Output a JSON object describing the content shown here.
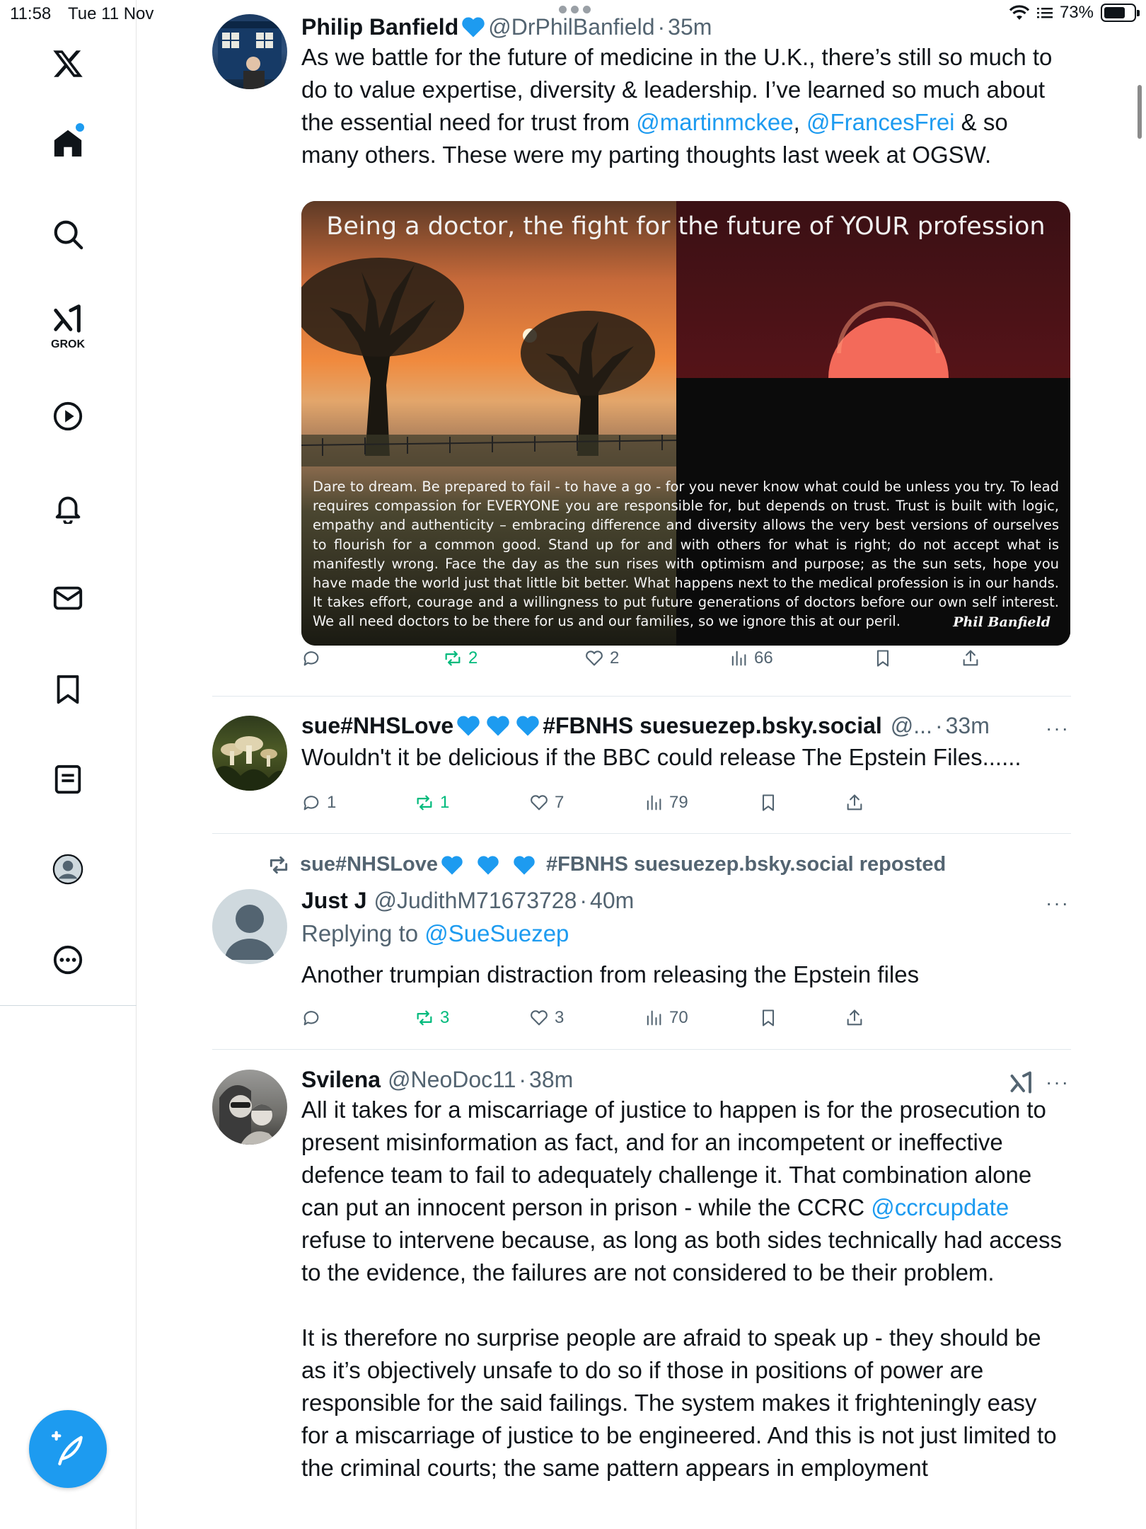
{
  "status_bar": {
    "time": "11:58",
    "date": "Tue 11 Nov",
    "battery": "73%",
    "battery_level": 0.73
  },
  "sidebar": {
    "items": [
      {
        "name": "logo",
        "icon": "x-logo-icon"
      },
      {
        "name": "home",
        "icon": "home-icon"
      },
      {
        "name": "explore",
        "icon": "search-icon"
      },
      {
        "name": "grok",
        "icon": "grok-icon",
        "label": "GROK"
      },
      {
        "name": "video",
        "icon": "play-icon"
      },
      {
        "name": "notifications",
        "icon": "bell-icon"
      },
      {
        "name": "messages",
        "icon": "mail-icon"
      },
      {
        "name": "bookmarks",
        "icon": "bookmark-icon"
      },
      {
        "name": "articles",
        "icon": "article-icon"
      },
      {
        "name": "profile",
        "icon": "avatar-icon"
      },
      {
        "name": "more",
        "icon": "more-circle-icon"
      }
    ],
    "compose_icon": "compose-feather-icon"
  },
  "colors": {
    "accent": "#1d9bf0",
    "retweet": "#00ba7c",
    "secondary_text": "#536471",
    "heart_blue": "#1d9bf0"
  },
  "tweets": [
    {
      "name": "Philip Banfield",
      "handle": "@DrPhilBanfield",
      "sep": "·",
      "time": "35m",
      "text_parts": [
        "As we battle for the future of medicine in the U.K., there’s still so much to do to value expertise, diversity & leadership. I’ve learned so much about the essential need for trust from ",
        "@martinmckee",
        ", ",
        "@FrancesFrei",
        " & so many others. These were my parting thoughts last week at OGSW."
      ],
      "media": {
        "title": "Being a doctor, the fight for the future of YOUR profession",
        "caption": "Dare to dream. Be prepared to fail - to have a go - for you never know what could be unless you try. To lead requires compassion for EVERYONE you are responsible for, but depends on trust. Trust is built with logic, empathy and authenticity – embracing difference and diversity allows the very best versions of ourselves to flourish for a common good. Stand up for and with others for what is right; do not accept what is manifestly wrong. Face the day as the sun rises with optimism and purpose; as the sun sets, hope you have made the world just that little bit better. What happens next to the medical profession is in our hands. It takes effort, courage and a willingness to put future generations of doctors before our own self interest. We all need doctors to be there for us and our families, so we ignore this at our peril.",
        "signature": "Phil Banfield"
      },
      "stats": {
        "replies": "",
        "reposts": "2",
        "likes": "2",
        "views": "66"
      }
    },
    {
      "name_prefix": "sue#NHSLove",
      "name_suffix": "#FBNHS suesuezep.bsky.social",
      "handle": "@...",
      "sep": "·",
      "time": "33m",
      "text": "Wouldn't it be delicious if the BBC could release The Epstein Files......",
      "more": "···",
      "stats": {
        "replies": "1",
        "reposts": "1",
        "likes": "7",
        "views": "79"
      }
    },
    {
      "repost_prefix": "sue#NHSLove",
      "repost_suffix": "#FBNHS suesuezep.bsky.social reposted",
      "name": "Just J",
      "handle": "@JudithM71673728",
      "sep": "·",
      "time": "40m",
      "replying_to_label": "Replying to ",
      "replying_to": "@SueSuezep",
      "text": "Another trumpian distraction from releasing the Epstein files",
      "more": "···",
      "stats": {
        "replies": "",
        "reposts": "3",
        "likes": "3",
        "views": "70"
      }
    },
    {
      "name": "Svilena",
      "handle": "@NeoDoc11",
      "sep": "·",
      "time": "38m",
      "more": "···",
      "text_parts": [
        "All it takes for a miscarriage of justice to happen is for the prosecution to present misinformation as fact, and for an incompetent or ineffective defence team to fail to adequately challenge it. That combination alone can put an innocent person in prison - while the CCRC ",
        "@ccrcupdate",
        " refuse to intervene because, as long as both sides technically had access to the evidence, the failures are not considered to be their problem."
      ],
      "text2": "It is therefore no surprise people are afraid to speak up - they should be as it’s objectively unsafe to do so if those in positions of power are responsible for the said failings. The system makes it frighteningly easy for a miscarriage of justice to be engineered. And this is not just limited to the criminal courts; the same pattern appears in employment"
    }
  ]
}
